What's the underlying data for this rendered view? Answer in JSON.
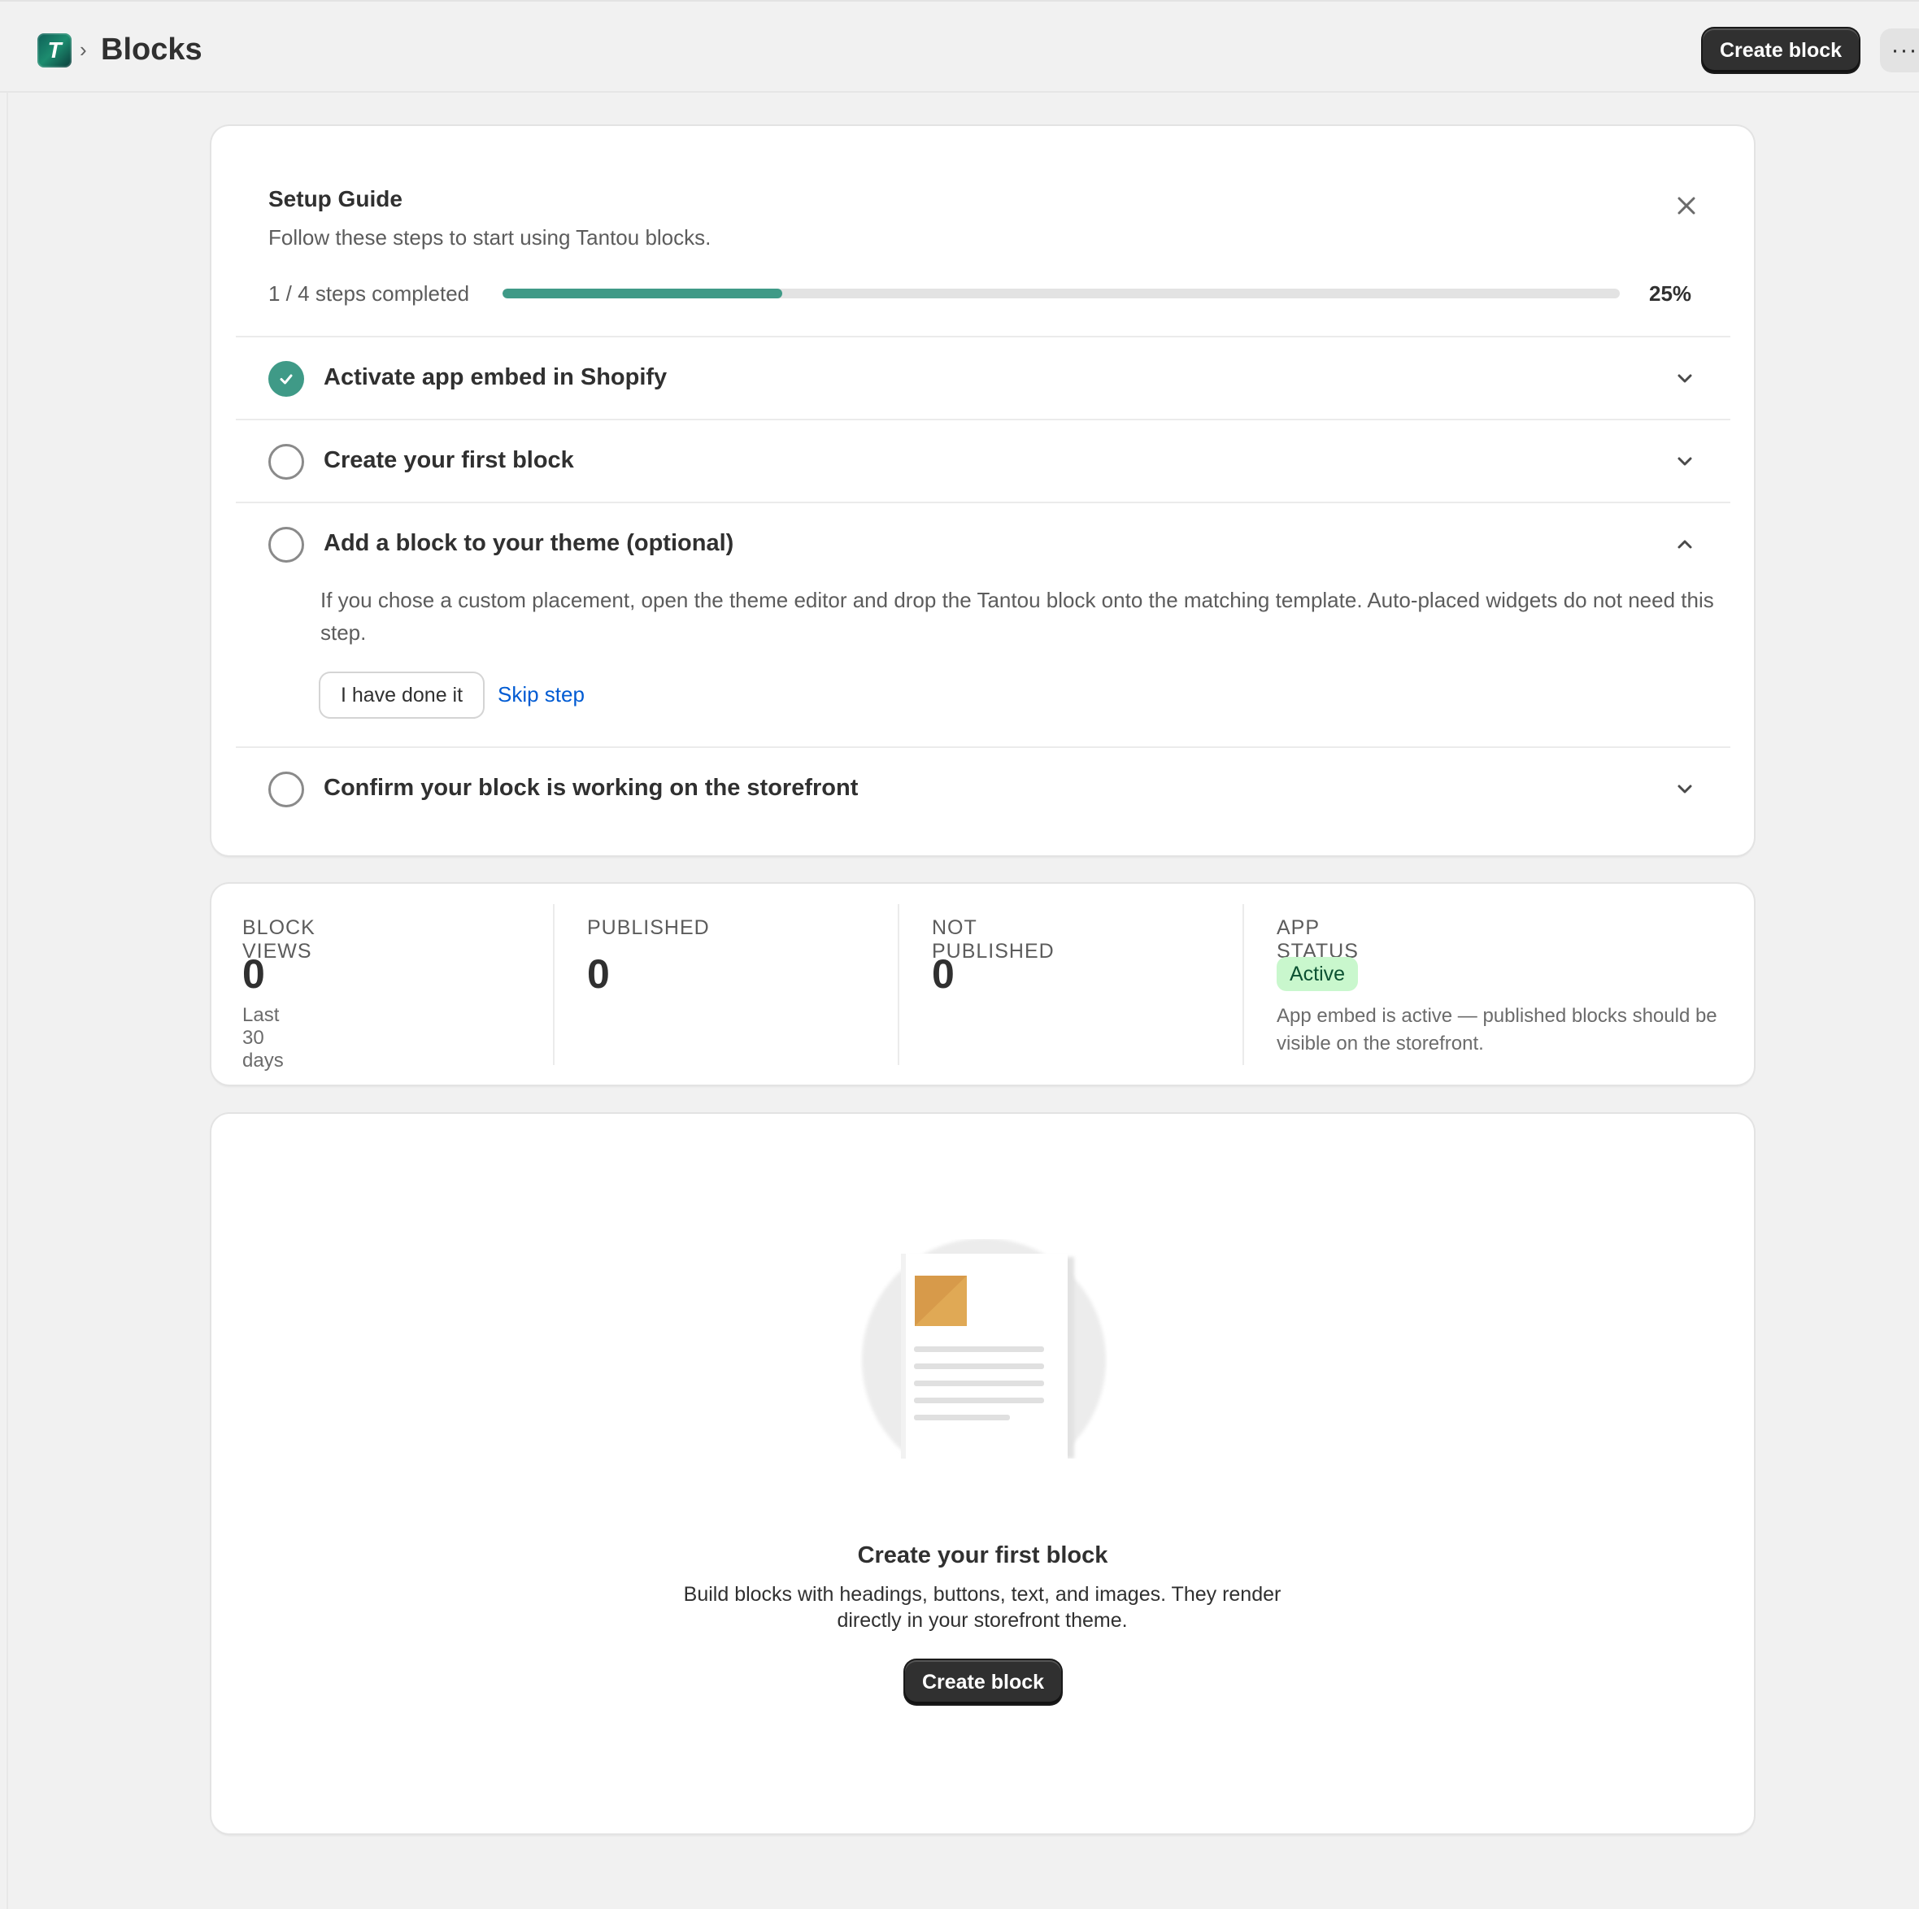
{
  "header": {
    "app_logo_letter": "T",
    "breadcrumb_separator": "›",
    "title": "Blocks",
    "create_button": "Create block",
    "more_button": "···"
  },
  "setup_guide": {
    "title": "Setup Guide",
    "subtitle": "Follow these steps to start using Tantou blocks.",
    "progress_label": "1 / 4 steps completed",
    "progress_percent": "25%",
    "progress_value": 0.25,
    "steps": [
      {
        "title": "Activate app embed in Shopify",
        "completed": true,
        "expanded": false
      },
      {
        "title": "Create your first block",
        "completed": false,
        "expanded": false
      },
      {
        "title": "Add a block to your theme (optional)",
        "completed": false,
        "expanded": true,
        "description": "If you chose a custom placement, open the theme editor and drop the Tantou block onto the matching template. Auto-placed widgets do not need this step.",
        "primary_action": "I have done it",
        "secondary_action": "Skip step"
      },
      {
        "title": "Confirm your block is working on the storefront",
        "completed": false,
        "expanded": false
      }
    ]
  },
  "stats": {
    "block_views": {
      "label": "BLOCK VIEWS",
      "value": "0",
      "note": "Last 30 days"
    },
    "published": {
      "label": "PUBLISHED",
      "value": "0"
    },
    "not_published": {
      "label": "NOT PUBLISHED",
      "value": "0"
    },
    "app_status": {
      "label": "APP STATUS",
      "badge": "Active",
      "description": "App embed is active — published blocks should be visible on the storefront."
    }
  },
  "empty_state": {
    "title": "Create your first block",
    "description": "Build blocks with headings, buttons, text, and images. They render directly in your storefront theme.",
    "button": "Create block"
  },
  "colors": {
    "progress_fill": "#3f9a87",
    "primary_button": "#303030",
    "link": "#005bd3",
    "badge_bg": "#c9f7cd",
    "badge_text": "#0c5132"
  }
}
